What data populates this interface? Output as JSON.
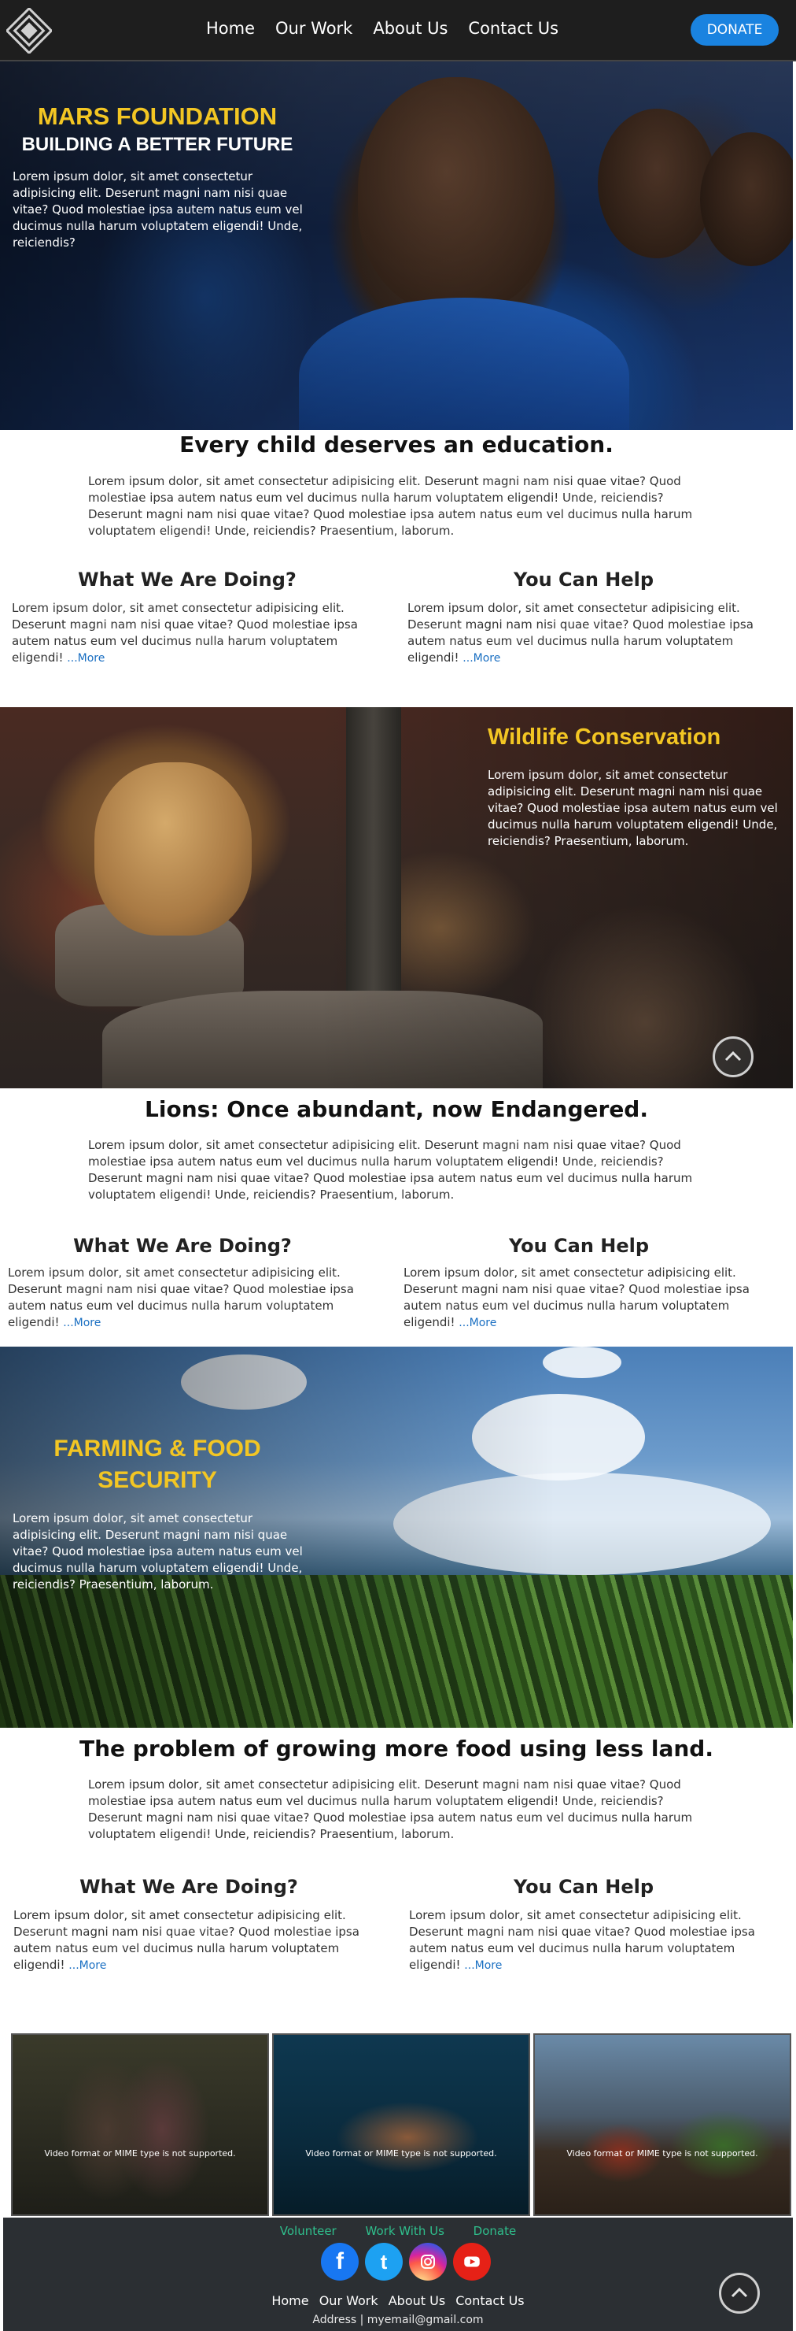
{
  "nav": {
    "links": [
      "Home",
      "Our Work",
      "About Us",
      "Contact Us"
    ],
    "donate_label": "DONATE"
  },
  "hero1": {
    "title": "MARS FOUNDATION",
    "subtitle": "BUILDING A BETTER FUTURE",
    "text": "Lorem ipsum dolor, sit amet consectetur adipisicing elit. Deserunt magni nam nisi quae vitae? Quod molestiae ipsa autem natus eum vel ducimus nulla harum voluptatem eligendi! Unde, reiciendis?"
  },
  "section1": {
    "heading": "Every child deserves an education.",
    "para": "Lorem ipsum dolor, sit amet consectetur adipisicing elit. Deserunt magni nam nisi quae vitae? Quod molestiae ipsa autem natus eum vel ducimus nulla harum voluptatem eligendi! Unde, reiciendis? Deserunt magni nam nisi quae vitae? Quod molestiae ipsa autem natus eum vel ducimus nulla harum voluptatem eligendi! Unde, reiciendis? Praesentium, laborum.",
    "col1_title": "What We Are Doing?",
    "col1_text": "Lorem ipsum dolor, sit amet consectetur adipisicing elit. Deserunt magni nam nisi quae vitae? Quod molestiae ipsa autem natus eum vel ducimus nulla harum voluptatem eligendi! ",
    "col2_title": "You Can Help",
    "col2_text": "Lorem ipsum dolor, sit amet consectetur adipisicing elit. Deserunt magni nam nisi quae vitae? Quod molestiae ipsa autem natus eum vel ducimus nulla harum voluptatem eligendi! ",
    "more": "...More"
  },
  "hero2": {
    "title": "Wildlife Conservation",
    "text": "Lorem ipsum dolor, sit amet consectetur adipisicing elit. Deserunt magni nam nisi quae vitae? Quod molestiae ipsa autem natus eum vel ducimus nulla harum voluptatem eligendi! Unde, reiciendis? Praesentium, laborum."
  },
  "section2": {
    "heading": "Lions: Once abundant, now Endangered.",
    "para": "Lorem ipsum dolor, sit amet consectetur adipisicing elit. Deserunt magni nam nisi quae vitae? Quod molestiae ipsa autem natus eum vel ducimus nulla harum voluptatem eligendi! Unde, reiciendis? Deserunt magni nam nisi quae vitae? Quod molestiae ipsa autem natus eum vel ducimus nulla harum voluptatem eligendi! Unde, reiciendis? Praesentium, laborum.",
    "col1_title": "What We Are Doing?",
    "col1_text": "Lorem ipsum dolor, sit amet consectetur adipisicing elit. Deserunt magni nam nisi quae vitae? Quod molestiae ipsa autem natus eum vel ducimus nulla harum voluptatem eligendi! ",
    "col2_title": "You Can Help",
    "col2_text": "Lorem ipsum dolor, sit amet consectetur adipisicing elit. Deserunt magni nam nisi quae vitae? Quod molestiae ipsa autem natus eum vel ducimus nulla harum voluptatem eligendi! ",
    "more": "...More"
  },
  "hero3": {
    "title": "FARMING & FOOD SECURITY",
    "text": "Lorem ipsum dolor, sit amet consectetur adipisicing elit. Deserunt magni nam nisi quae vitae? Quod molestiae ipsa autem natus eum vel ducimus nulla harum voluptatem eligendi! Unde, reiciendis? Praesentium, laborum."
  },
  "section3": {
    "heading": "The problem of growing more food using less land.",
    "para": "Lorem ipsum dolor, sit amet consectetur adipisicing elit. Deserunt magni nam nisi quae vitae? Quod molestiae ipsa autem natus eum vel ducimus nulla harum voluptatem eligendi! Unde, reiciendis? Deserunt magni nam nisi quae vitae? Quod molestiae ipsa autem natus eum vel ducimus nulla harum voluptatem eligendi! Unde, reiciendis? Praesentium, laborum.",
    "col1_title": "What We Are Doing?",
    "col1_text": "Lorem ipsum dolor, sit amet consectetur adipisicing elit. Deserunt magni nam nisi quae vitae? Quod molestiae ipsa autem natus eum vel ducimus nulla harum voluptatem eligendi! ",
    "col2_title": "You Can Help",
    "col2_text": "Lorem ipsum dolor, sit amet consectetur adipisicing elit. Deserunt magni nam nisi quae vitae? Quod molestiae ipsa autem natus eum vel ducimus nulla harum voluptatem eligendi! ",
    "more": "...More"
  },
  "videos": {
    "message": "Video format or MIME type is not supported."
  },
  "footer": {
    "top_links": [
      "Volunteer",
      "Work With Us",
      "Donate"
    ],
    "nav_links": [
      "Home",
      "Our Work",
      "About Us",
      "Contact Us"
    ],
    "address": "Address | myemail@gmail.com",
    "social_icons": [
      "facebook-icon",
      "twitter-icon",
      "instagram-icon",
      "youtube-icon"
    ]
  },
  "colors": {
    "accent_yellow": "#f3c623",
    "donate_blue": "#1a83e0",
    "footer_link_green": "#2fbf8c",
    "link_blue": "#1a6fc2"
  }
}
